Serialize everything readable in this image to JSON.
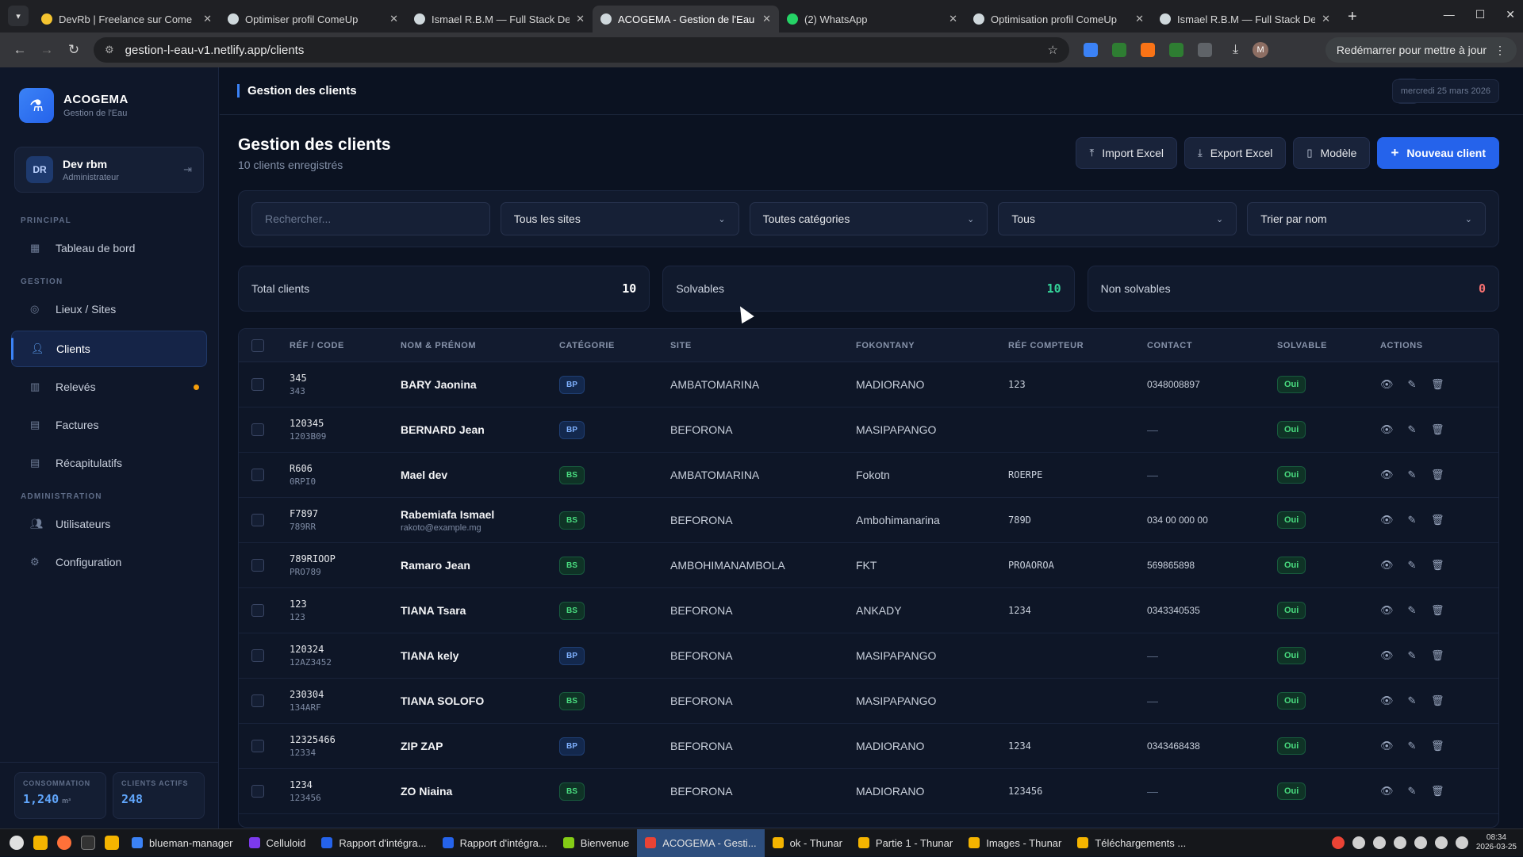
{
  "browser": {
    "tabs": [
      {
        "title": "DevRb | Freelance sur Come",
        "color": "#f4c430"
      },
      {
        "title": "Optimiser profil ComeUp",
        "color": "#cfd8dc"
      },
      {
        "title": "Ismael R.B.M — Full Stack De",
        "color": "#cfd8dc"
      },
      {
        "title": "ACOGEMA - Gestion de l'Eau",
        "color": "#cfd8dc",
        "active": true
      },
      {
        "title": "(2) WhatsApp",
        "color": "#25d366"
      },
      {
        "title": "Optimisation profil ComeUp",
        "color": "#cfd8dc"
      },
      {
        "title": "Ismael R.B.M — Full Stack De",
        "color": "#cfd8dc"
      }
    ],
    "url": "gestion-l-eau-v1.netlify.app/clients",
    "restart_label": "Redémarrer pour mettre à jour",
    "profile_initial": "M"
  },
  "app": {
    "brand_name": "ACOGEMA",
    "brand_sub": "Gestion de l'Eau",
    "user": {
      "initials": "DR",
      "name": "Dev rbm",
      "role": "Administrateur"
    },
    "sections": {
      "principal": "PRINCIPAL",
      "gestion": "GESTION",
      "admin": "ADMINISTRATION"
    },
    "nav": {
      "dashboard": "Tableau de bord",
      "sites": "Lieux / Sites",
      "clients": "Clients",
      "releves": "Relevés",
      "factures": "Factures",
      "recap": "Récapitulatifs",
      "users": "Utilisateurs",
      "config": "Configuration"
    },
    "footer": {
      "consumption_label": "CONSOMMATION",
      "consumption_value": "1,240",
      "consumption_unit": "m³",
      "active_label": "CLIENTS ACTIFS",
      "active_value": "248"
    },
    "breadcrumb": "Gestion des clients",
    "date": "mercredi 25 mars 2026"
  },
  "page": {
    "title": "Gestion des clients",
    "subtitle": "10 clients enregistrés",
    "buttons": {
      "import": "Import Excel",
      "export": "Export Excel",
      "model": "Modèle",
      "new": "Nouveau client"
    },
    "filters": {
      "search_placeholder": "Rechercher...",
      "site": "Tous les sites",
      "category": "Toutes catégories",
      "status": "Tous",
      "sort": "Trier par nom"
    },
    "stats": {
      "total_label": "Total clients",
      "total_value": "10",
      "solv_label": "Solvables",
      "solv_value": "10",
      "nonsolv_label": "Non solvables",
      "nonsolv_value": "0",
      "total_color": "#ffffff",
      "solv_color": "#34d399",
      "nonsolv_color": "#f87171"
    }
  },
  "table": {
    "headers": [
      "RÉF / CODE",
      "NOM & PRÉNOM",
      "CATÉGORIE",
      "SITE",
      "FOKONTANY",
      "RÉF COMPTEUR",
      "CONTACT",
      "SOLVABLE",
      "ACTIONS"
    ],
    "rows": [
      {
        "ref": "345",
        "code": "343",
        "name": "BARY Jaonina",
        "email": "",
        "cat": "BP",
        "site": "AMBATOMARINA",
        "fkt": "MADIORANO",
        "compteur": "123",
        "contact": "0348008897",
        "solv": "Oui"
      },
      {
        "ref": "120345",
        "code": "1203B09",
        "name": "BERNARD Jean",
        "email": "",
        "cat": "BP",
        "site": "BEFORONA",
        "fkt": "MASIPAPANGO",
        "compteur": "",
        "contact": "—",
        "solv": "Oui"
      },
      {
        "ref": "R606",
        "code": "0RPI0",
        "name": "Mael dev",
        "email": "",
        "cat": "BS",
        "site": "AMBATOMARINA",
        "fkt": "Fokotn",
        "compteur": "ROERPE",
        "contact": "—",
        "solv": "Oui"
      },
      {
        "ref": "F7897",
        "code": "789RR",
        "name": "Rabemiafa Ismael",
        "email": "rakoto@example.mg",
        "cat": "BS",
        "site": "BEFORONA",
        "fkt": "Ambohimanarina",
        "compteur": "789D",
        "contact": "034 00 000 00",
        "solv": "Oui"
      },
      {
        "ref": "789RIOOP",
        "code": "PRO789",
        "name": "Ramaro Jean",
        "email": "",
        "cat": "BS",
        "site": "AMBOHIMANAMBOLA",
        "fkt": "FKT",
        "compteur": "PROAOROA",
        "contact": "569865898",
        "solv": "Oui"
      },
      {
        "ref": "123",
        "code": "123",
        "name": "TIANA Tsara",
        "email": "",
        "cat": "BS",
        "site": "BEFORONA",
        "fkt": "ANKADY",
        "compteur": "1234",
        "contact": "0343340535",
        "solv": "Oui"
      },
      {
        "ref": "120324",
        "code": "12AZ3452",
        "name": "TIANA kely",
        "email": "",
        "cat": "BP",
        "site": "BEFORONA",
        "fkt": "MASIPAPANGO",
        "compteur": "",
        "contact": "—",
        "solv": "Oui"
      },
      {
        "ref": "230304",
        "code": "134ARF",
        "name": "TIANA SOLOFO",
        "email": "",
        "cat": "BS",
        "site": "BEFORONA",
        "fkt": "MASIPAPANGO",
        "compteur": "",
        "contact": "—",
        "solv": "Oui"
      },
      {
        "ref": "12325466",
        "code": "12334",
        "name": "ZIP ZAP",
        "email": "",
        "cat": "BP",
        "site": "BEFORONA",
        "fkt": "MADIORANO",
        "compteur": "1234",
        "contact": "0343468438",
        "solv": "Oui"
      },
      {
        "ref": "1234",
        "code": "123456",
        "name": "ZO Niaina",
        "email": "",
        "cat": "BS",
        "site": "BEFORONA",
        "fkt": "MADIORANO",
        "compteur": "123456",
        "contact": "—",
        "solv": "Oui"
      }
    ]
  },
  "taskbar": {
    "items": [
      {
        "label": "blueman-manager",
        "color": "#3b82f6"
      },
      {
        "label": "Celluloid",
        "color": "#7c3aed"
      },
      {
        "label": "Rapport d'intégra...",
        "color": "#2563eb"
      },
      {
        "label": "Rapport d'intégra...",
        "color": "#2563eb"
      },
      {
        "label": "Bienvenue",
        "color": "#84cc16"
      },
      {
        "label": "ACOGEMA - Gesti...",
        "color": "#ea4335",
        "active": true
      },
      {
        "label": "ok - Thunar",
        "color": "#f4b400"
      },
      {
        "label": "Partie 1 - Thunar",
        "color": "#f4b400"
      },
      {
        "label": "Images - Thunar",
        "color": "#f4b400"
      },
      {
        "label": "Téléchargements ...",
        "color": "#f4b400"
      }
    ],
    "time": "08:34",
    "date": "2026-03-25"
  }
}
